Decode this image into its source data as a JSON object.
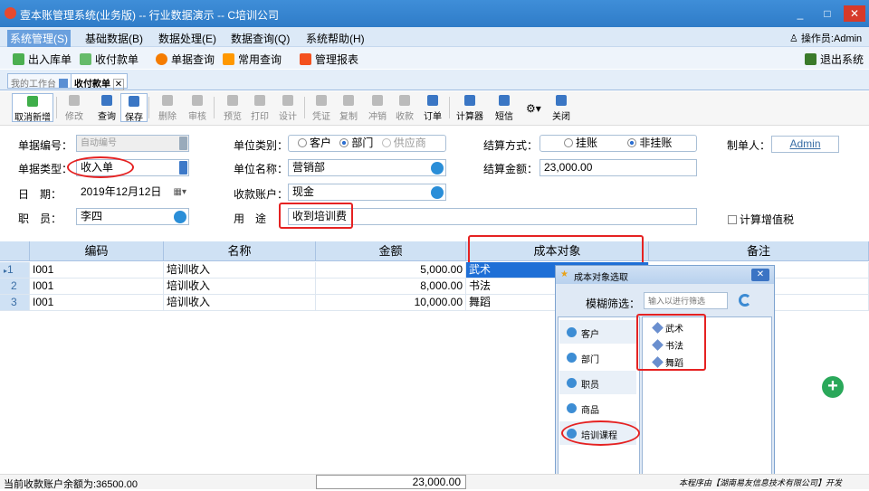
{
  "window": {
    "title": "壹本账管理系统(业务版) -- 行业数据演示 -- C培训公司",
    "btn_min": "_",
    "btn_max": "□",
    "btn_close": "✕"
  },
  "menubar": {
    "items": [
      "系统管理(S)",
      "基础数据(B)",
      "数据处理(E)",
      "数据查询(Q)",
      "系统帮助(H)"
    ],
    "operator": "操作员:Admin"
  },
  "quickbar": {
    "items": [
      "出入库单",
      "收付款单",
      "单据查询",
      "常用查询",
      "管理报表"
    ],
    "exit": "退出系统"
  },
  "tabs": {
    "home": "我的工作台",
    "current": "收付款单",
    "close": "✕"
  },
  "toolbar": {
    "buttons": [
      "取消新增",
      "修改",
      "查询",
      "保存",
      "删除",
      "审核",
      "预览",
      "打印",
      "设计",
      "凭证",
      "复制",
      "冲销",
      "收款",
      "订单",
      "计算器",
      "短信",
      "关闭"
    ]
  },
  "form": {
    "doc_no_label": "单据编号：",
    "doc_no": "自动编号",
    "doc_type_label": "单据类型：",
    "doc_type": "收入单",
    "date_label": "日　期：",
    "date": "2019年12月12日",
    "staff_label": "职　员：",
    "staff": "李四",
    "unit_type_label": "单位类别：",
    "unit_types": [
      "客户",
      "部门",
      "供应商"
    ],
    "unit_name_label": "单位名称：",
    "unit_name": "营销部",
    "account_label": "收款账户：",
    "account": "现金",
    "purpose_label": "用　途",
    "purpose": "收到培训费",
    "settle_label": "结算方式：",
    "settle_options": [
      "挂账",
      "非挂账"
    ],
    "amount_label": "结算金额：",
    "amount": "23,000.00",
    "maker_label": "制单人：",
    "maker": "Admin",
    "vat_label": "计算增值税"
  },
  "grid": {
    "headers": [
      "编码",
      "名称",
      "金额",
      "成本对象",
      "备注"
    ],
    "rows": [
      {
        "no": "1",
        "code": "I001",
        "name": "培训收入",
        "amount": "5,000.00",
        "cost": "武术"
      },
      {
        "no": "2",
        "code": "I001",
        "name": "培训收入",
        "amount": "8,000.00",
        "cost": "书法"
      },
      {
        "no": "3",
        "code": "I001",
        "name": "培训收入",
        "amount": "10,000.00",
        "cost": "舞蹈"
      }
    ],
    "total": "23,000.00"
  },
  "popup": {
    "title": "成本对象选取",
    "filter_label": "模糊筛选：",
    "filter_placeholder": "输入以进行筛选",
    "categories": [
      "客户",
      "部门",
      "职员",
      "商品",
      "培训课程"
    ],
    "tree": [
      "武术",
      "书法",
      "舞蹈"
    ]
  },
  "status": {
    "left": "当前收款账户余额为:36500.00",
    "right": "本程序由【湖南易友信息技术有限公司】开发"
  },
  "colors": {
    "title": "#2f7cc8",
    "header": "#cfe1f4",
    "highlight": "#e52222",
    "select": "#1e6fd6"
  }
}
